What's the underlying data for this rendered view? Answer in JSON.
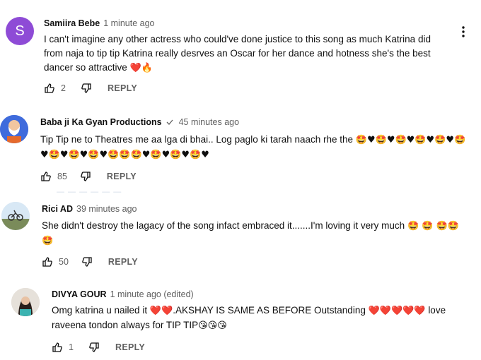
{
  "comments": [
    {
      "author": "Samiira Bebe",
      "time": "1 minute ago",
      "avatar_letter": "S",
      "avatar_color": "#8e4bd6",
      "text": "I can't imagine any other actress who could've done justice to this song as much Katrina did from naja to tip tip Katrina really desrves an Oscar for her dance and hotness she's the best dancer so attractive",
      "emoji": "❤️🔥",
      "likes": "2",
      "reply_label": "REPLY"
    },
    {
      "author": "Baba ji Ka Gyan Productions",
      "time": "45 minutes ago",
      "verified": true,
      "text": "Tip Tip ne to Theatres me aa lga di bhai.. Log paglo ki tarah naach rhe the",
      "emoji": "🤩♥🤩♥🤩♥🤩♥🤩♥🤩♥🤩♥🤩♥🤩♥🤩🤩🤩♥🤩♥🤩♥🤩♥",
      "likes": "85",
      "reply_label": "REPLY"
    },
    {
      "author": "Rici AD",
      "time": "39 minutes ago",
      "text": "She didn't destroy the lagacy of the song infact embraced it.......I'm loving it very much",
      "emoji": "🤩 🤩 🤩🤩🤩",
      "likes": "50",
      "reply_label": "REPLY"
    },
    {
      "author": "DIVYA GOUR",
      "time": "1 minute ago (edited)",
      "text_part1": "Omg katrina u nailed it",
      "emoji1": "❤️❤️",
      "text_part2": ".AKSHAY IS SAME AS BEFORE Outstanding",
      "emoji2": "❤️❤️❤️❤️❤️",
      "text_part3": "love raveena tondon always for TIP TIP",
      "emoji3": "😘😘😘",
      "likes": "1",
      "reply_label": "REPLY"
    }
  ],
  "more_icon": "three-dots-vertical",
  "colors": {
    "accent_heart": "#e11d2e",
    "muted": "#606060"
  }
}
